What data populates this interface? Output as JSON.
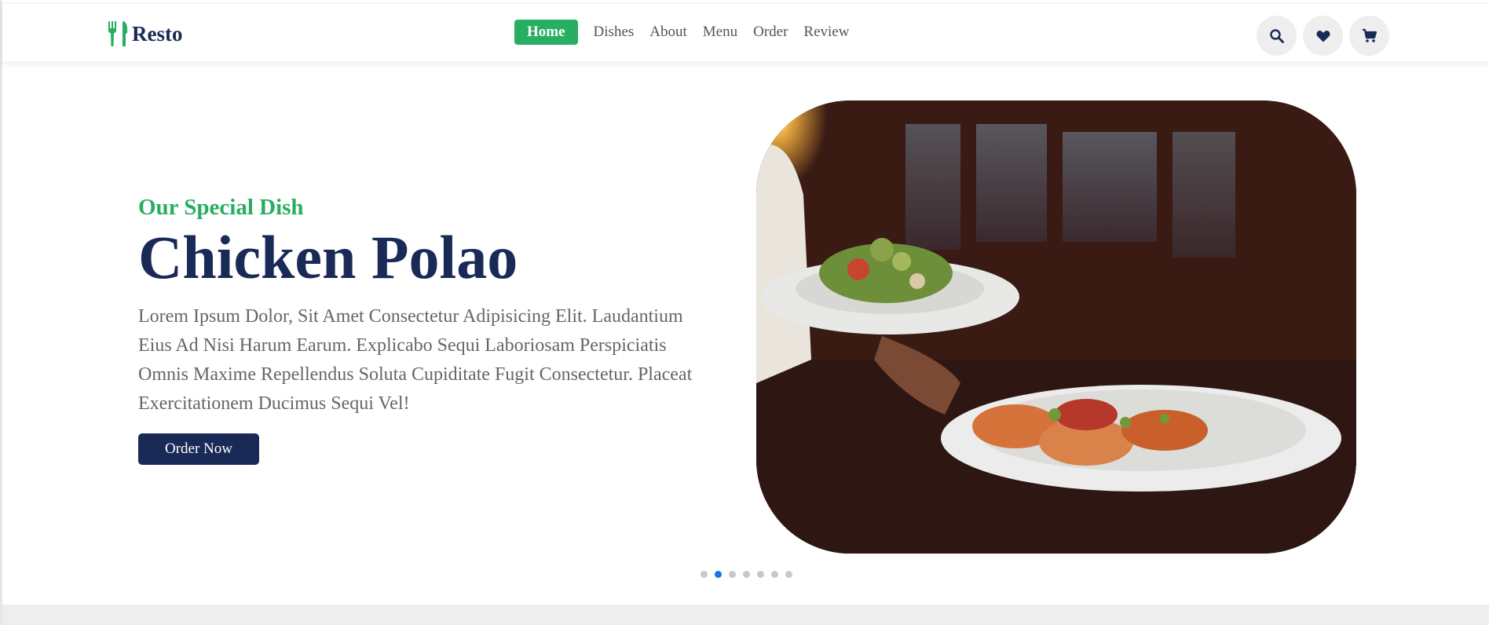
{
  "header": {
    "logo_text": "Resto",
    "logo_icon": "utensils-icon",
    "nav": [
      {
        "label": "Home",
        "active": true
      },
      {
        "label": "Dishes",
        "active": false
      },
      {
        "label": "About",
        "active": false
      },
      {
        "label": "Menu",
        "active": false
      },
      {
        "label": "Order",
        "active": false
      },
      {
        "label": "Review",
        "active": false
      }
    ],
    "icons": [
      "search-icon",
      "heart-icon",
      "cart-icon"
    ]
  },
  "hero": {
    "subtitle": "Our Special Dish",
    "title": "Chicken Polao",
    "description": "Lorem Ipsum Dolor, Sit Amet Consectetur Adipisicing Elit. Laudantium Eius Ad Nisi Harum Earum. Explicabo Sequi Laboriosam Perspiciatis Omnis Maxime Repellendus Soluta Cupiditate Fugit Consectetur. Placeat Exercitationem Ducimus Sequi Vel!",
    "button_label": "Order Now"
  },
  "slider": {
    "count": 7,
    "active_index": 1
  },
  "colors": {
    "accent": "#27ae60",
    "primary": "#192a56",
    "dot_active": "#1a73e8"
  }
}
